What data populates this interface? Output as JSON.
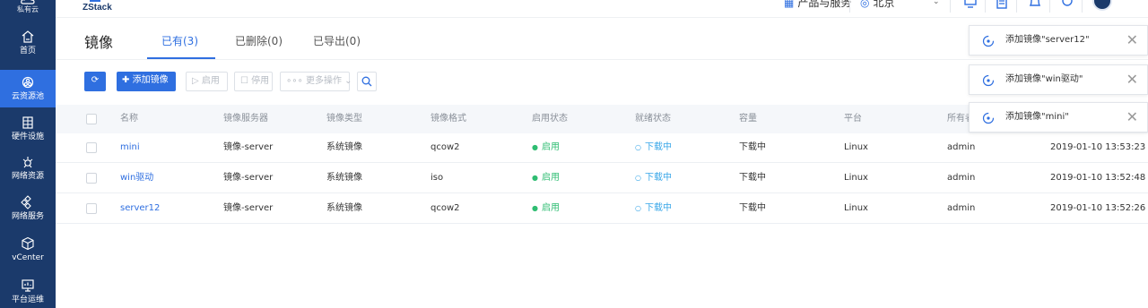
{
  "sidebar": {
    "top_label": "私有云",
    "items": [
      {
        "label": "首页",
        "icon": "home-icon"
      },
      {
        "label": "云资源池",
        "icon": "cloud-resource-icon",
        "active": true
      },
      {
        "label": "硬件设施",
        "icon": "hardware-icon"
      },
      {
        "label": "网络资源",
        "icon": "network-resource-icon"
      },
      {
        "label": "网络服务",
        "icon": "network-service-icon"
      },
      {
        "label": "vCenter",
        "icon": "vcenter-icon"
      },
      {
        "label": "平台运维",
        "icon": "platform-ops-icon"
      }
    ]
  },
  "topbar": {
    "logo_text": "ZStack",
    "product": "产品与服务",
    "region": "北京"
  },
  "page": {
    "title": "镜像",
    "tabs": [
      "已有(3)",
      "已删除(0)",
      "已导出(0)"
    ]
  },
  "toolbar": {
    "add": "添加镜像",
    "enable": "启用",
    "disable": "停用",
    "more": "更多操作"
  },
  "table": {
    "columns": [
      "名称",
      "镜像服务器",
      "镜像类型",
      "镜像格式",
      "启用状态",
      "就绪状态",
      "容量",
      "平台",
      "所有者",
      ""
    ],
    "rows": [
      [
        "mini",
        "镜像-server",
        "系统镜像",
        "qcow2",
        "启用",
        "下载中",
        "下载中",
        "Linux",
        "admin",
        "2019-01-10 13:53:23"
      ],
      [
        "win驱动",
        "镜像-server",
        "系统镜像",
        "iso",
        "启用",
        "下载中",
        "下载中",
        "Linux",
        "admin",
        "2019-01-10 13:52:48"
      ],
      [
        "server12",
        "镜像-server",
        "系统镜像",
        "qcow2",
        "启用",
        "下载中",
        "下载中",
        "Linux",
        "admin",
        "2019-01-10 13:52:26"
      ]
    ]
  },
  "notifications": [
    {
      "text": "添加镜像\"server12\""
    },
    {
      "text": "添加镜像\"win驱动\""
    },
    {
      "text": "添加镜像\"mini\""
    }
  ],
  "colors": {
    "sidebar": "#1b3a6b",
    "accent": "#2f6fe0",
    "enabled": "#2fbd72",
    "downloading": "#37a6e8"
  }
}
